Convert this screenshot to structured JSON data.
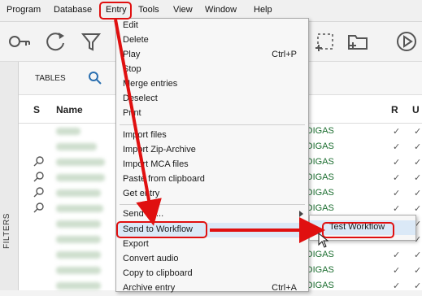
{
  "menubar": {
    "items": [
      {
        "label": "Program",
        "id": "program"
      },
      {
        "label": "Database",
        "id": "database"
      },
      {
        "label": "Entry",
        "id": "entry"
      },
      {
        "label": "Tools",
        "id": "tools"
      },
      {
        "label": "View",
        "id": "view"
      },
      {
        "label": "Window",
        "id": "window"
      },
      {
        "label": "Help",
        "id": "help"
      }
    ]
  },
  "sidebar": {
    "filters_label": "FILTERS"
  },
  "tabs": {
    "tables_label": "TABLES"
  },
  "table": {
    "headers": {
      "s": "S",
      "name": "Name",
      "r": "R",
      "u": "U"
    },
    "digas_text": "-DIGAS",
    "check": "✓"
  },
  "entry_menu": {
    "items": [
      {
        "label": "Edit",
        "shortcut": ""
      },
      {
        "label": "Delete",
        "shortcut": ""
      },
      {
        "label": "Play",
        "shortcut": "Ctrl+P"
      },
      {
        "label": "Stop",
        "shortcut": ""
      },
      {
        "label": "Merge entries",
        "shortcut": ""
      },
      {
        "label": "Deselect",
        "shortcut": ""
      },
      {
        "label": "Print",
        "shortcut": ""
      },
      {
        "label": "Import files",
        "shortcut": ""
      },
      {
        "label": "Import Zip-Archive",
        "shortcut": ""
      },
      {
        "label": "Import MCA files",
        "shortcut": ""
      },
      {
        "label": "Paste from clipboard",
        "shortcut": ""
      },
      {
        "label": "Get entry",
        "shortcut": ""
      },
      {
        "label": "Send to ...",
        "shortcut": ""
      },
      {
        "label": "Send to Workflow",
        "shortcut": ""
      },
      {
        "label": "Export",
        "shortcut": ""
      },
      {
        "label": "Convert audio",
        "shortcut": ""
      },
      {
        "label": "Copy to clipboard",
        "shortcut": ""
      },
      {
        "label": "Archive entry",
        "shortcut": "Ctrl+A"
      }
    ]
  },
  "workflow_submenu": {
    "items": [
      {
        "label": "Test Workflow"
      }
    ]
  },
  "colors": {
    "highlight_red": "#e01010",
    "digas_green": "#1b6d2f",
    "menu_hover": "#dbe9f7"
  },
  "icons": [
    "key-icon",
    "refresh-icon",
    "filter-icon",
    "selection-add-icon",
    "folder-add-icon",
    "play-circle-icon",
    "search-icon",
    "magnifier-icon"
  ]
}
